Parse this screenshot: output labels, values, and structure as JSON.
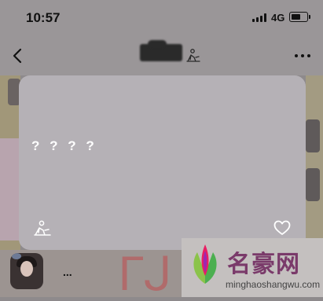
{
  "status_bar": {
    "time": "10:57",
    "network": "4G",
    "battery_level": 0.6
  },
  "nav_bar": {
    "back_icon": "chevron-left-icon",
    "title_badge_icon": "person-lounging-icon",
    "more_icon": "ellipsis-icon"
  },
  "popup": {
    "text": "? ? ? ?",
    "badge_icon": "person-lounging-icon",
    "like_icon": "heart-outline-icon"
  },
  "chat_preview": {
    "dots": "..."
  },
  "watermark": {
    "brand": "名豪网",
    "url": "minghaoshangwu.com"
  },
  "colors": {
    "dim_overlay": "#8e8a8c",
    "card": "#b5b1b6",
    "text_on_card": "#ffffff",
    "status_text": "#111111"
  }
}
